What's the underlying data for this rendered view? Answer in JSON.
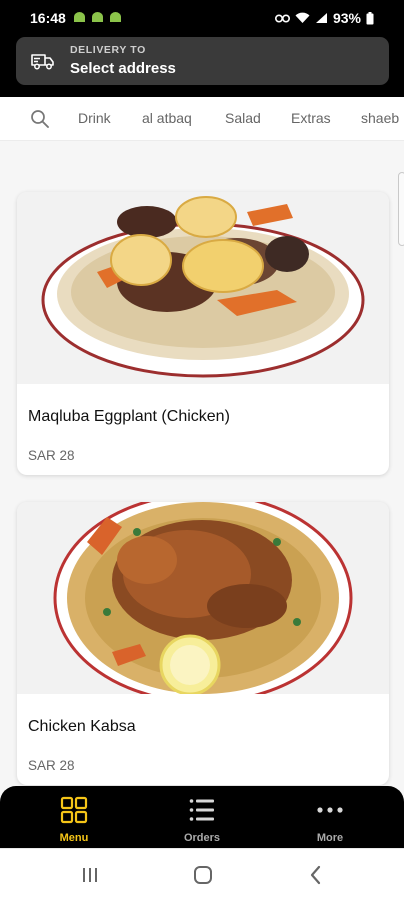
{
  "status": {
    "time": "16:48",
    "battery": "93%"
  },
  "delivery": {
    "label": "DELIVERY TO",
    "value": "Select address"
  },
  "tabs": [
    "Drink",
    "al atbaq",
    "Salad",
    "Extras",
    "shaeb"
  ],
  "items": [
    {
      "name": "Maqluba Eggplant (Chicken)",
      "price": "SAR 28"
    },
    {
      "name": "Chicken Kabsa",
      "price": "SAR 28"
    }
  ],
  "nav": {
    "menu": "Menu",
    "orders": "Orders",
    "more": "More"
  },
  "colors": {
    "accent": "#f5c518",
    "header": "#000000"
  }
}
